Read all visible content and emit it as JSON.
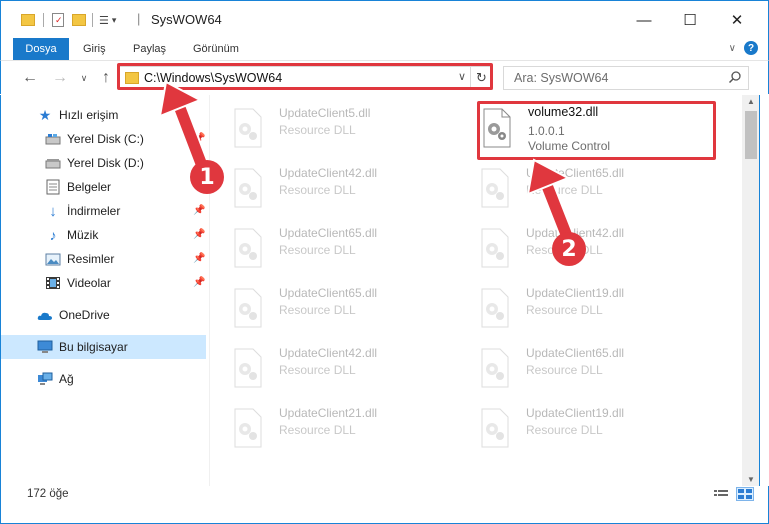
{
  "window": {
    "title": "SysWOW64",
    "minimize": "—",
    "maximize": "☐",
    "close": "✕"
  },
  "ribbon": {
    "tabs": [
      "Dosya",
      "Giriş",
      "Paylaş",
      "Görünüm"
    ],
    "file_color": "#1979ca"
  },
  "nav": {
    "back": "←",
    "forward": "→",
    "recent": "∨",
    "up": "↑"
  },
  "address": {
    "path": "C:\\Windows\\SysWOW64",
    "refresh": "↻"
  },
  "search": {
    "placeholder": "Ara: SysWOW64"
  },
  "sidebar": {
    "items": [
      {
        "label": "Hızlı erişim",
        "icon": "star-icon"
      },
      {
        "label": "Yerel Disk (C:)",
        "icon": "drive-icon"
      },
      {
        "label": "Yerel Disk (D:)",
        "icon": "drive-icon"
      },
      {
        "label": "Belgeler",
        "icon": "documents-icon"
      },
      {
        "label": "İndirmeler",
        "icon": "download-icon"
      },
      {
        "label": "Müzik",
        "icon": "music-icon"
      },
      {
        "label": "Resimler",
        "icon": "pictures-icon"
      },
      {
        "label": "Videolar",
        "icon": "videos-icon"
      },
      {
        "label": "OneDrive",
        "icon": "cloud-icon"
      },
      {
        "label": "Bu bilgisayar",
        "icon": "computer-icon"
      },
      {
        "label": "Ağ",
        "icon": "network-icon"
      }
    ]
  },
  "files": {
    "left": [
      {
        "name": "UpdateClient5.dll",
        "desc": "Resource DLL"
      },
      {
        "name": "UpdateClient42.dll",
        "desc": "Resource DLL"
      },
      {
        "name": "UpdateClient65.dll",
        "desc": "Resource DLL"
      },
      {
        "name": "UpdateClient65.dll",
        "desc": "Resource DLL"
      },
      {
        "name": "UpdateClient42.dll",
        "desc": "Resource DLL"
      },
      {
        "name": "UpdateClient21.dll",
        "desc": "Resource DLL"
      }
    ],
    "right": [
      {
        "name": "UpdateClient65.dll",
        "desc": "Resource DLL"
      },
      {
        "name": "UpdateClient42.dll",
        "desc": "Resource DLL"
      },
      {
        "name": "UpdateClient19.dll",
        "desc": "Resource DLL"
      },
      {
        "name": "UpdateClient65.dll",
        "desc": "Resource DLL"
      },
      {
        "name": "UpdateClient19.dll",
        "desc": "Resource DLL"
      }
    ],
    "featured": {
      "name": "volume32.dll",
      "version": "1.0.0.1",
      "desc": "Volume Control"
    }
  },
  "status": {
    "count": "172 öğe"
  },
  "annotations": {
    "step1": "1",
    "step2": "2",
    "color": "#e0373e"
  }
}
